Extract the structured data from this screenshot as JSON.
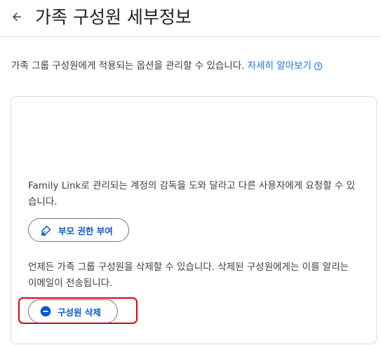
{
  "header": {
    "back_icon": "arrow-back-icon",
    "title": "가족 구성원 세부정보"
  },
  "intro": {
    "text": "가족 그룹 구성원에게 적용되는 옵션을 관리할 수 있습니다. ",
    "learn_more": "자세히 알아보기",
    "help_icon": "help-circle-icon"
  },
  "card": {
    "family_link_text": "Family Link로 관리되는 계정의 감독을 도와 달라고 다른 사용자에게 요청할 수 있습니다.",
    "grant_button": {
      "label": "부모 권한 부여",
      "icon": "shield-pen-icon"
    },
    "remove_text": "언제든 가족 그룹 구성원을 삭제할 수 있습니다. 삭제된 구성원에게는 이를 알리는 이메일이 전송됩니다.",
    "remove_button": {
      "label": "구성원 삭제",
      "icon": "remove-circle-icon"
    }
  },
  "colors": {
    "accent": "#0b57d0",
    "link": "#1a73e8",
    "highlight": "#e3000f",
    "text": "#3c4043",
    "border": "#dadce0"
  }
}
